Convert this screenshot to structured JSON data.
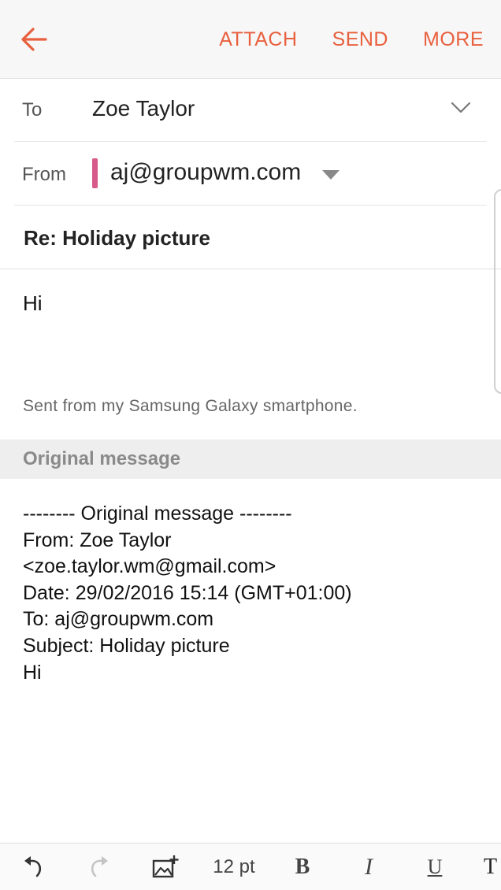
{
  "colors": {
    "accent": "#e8603e",
    "account_mark": "#d85a8a"
  },
  "topbar": {
    "back_icon": "arrow-left-icon",
    "actions": {
      "attach": "ATTACH",
      "send": "SEND",
      "more": "MORE"
    }
  },
  "header": {
    "to_label": "To",
    "to_value": "Zoe Taylor",
    "from_label": "From",
    "from_value": "aj@groupwm.com",
    "subject": "Re: Holiday picture"
  },
  "body": {
    "text": "Hi",
    "signature": "Sent from my Samsung Galaxy smartphone."
  },
  "original": {
    "section_label": "Original message",
    "lines": [
      "-------- Original message --------",
      "From: Zoe Taylor",
      "<zoe.taylor.wm@gmail.com>",
      "Date: 29/02/2016 15:14 (GMT+01:00)",
      "To: aj@groupwm.com",
      "Subject: Holiday picture",
      "",
      "Hi"
    ]
  },
  "toolbar": {
    "undo_icon": "undo-icon",
    "redo_icon": "redo-icon",
    "image_icon": "insert-image-icon",
    "font_size": "12 pt",
    "bold": "B",
    "italic": "I",
    "underline": "U",
    "more": "T"
  }
}
